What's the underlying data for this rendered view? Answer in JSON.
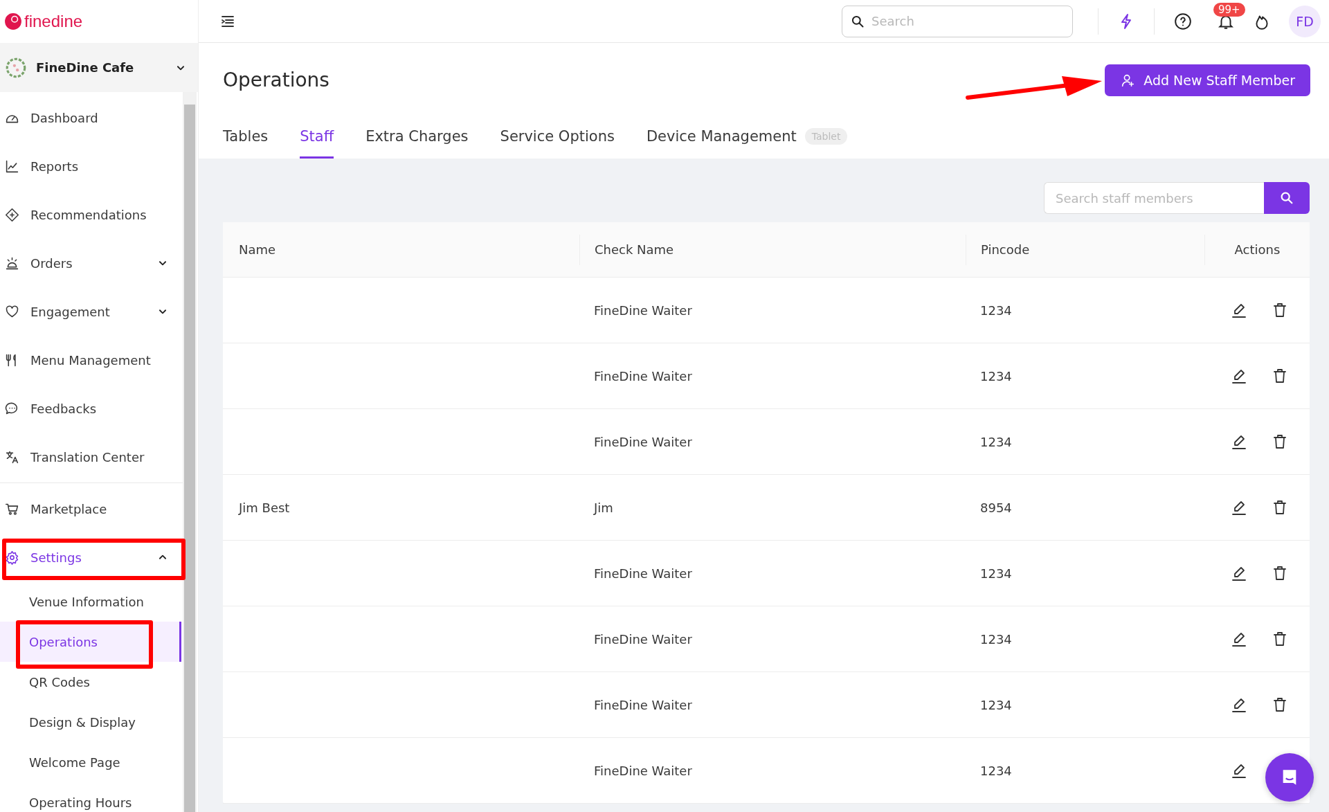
{
  "brand": {
    "name": "finedine"
  },
  "venue": {
    "name": "FineDine Cafe",
    "expanded": false
  },
  "sidebar": {
    "items": [
      {
        "kind": "link",
        "label": "Dashboard"
      },
      {
        "kind": "link",
        "label": "Reports"
      },
      {
        "kind": "link",
        "label": "Recommendations"
      },
      {
        "kind": "group",
        "label": "Orders",
        "expanded": false
      },
      {
        "kind": "group",
        "label": "Engagement",
        "expanded": false
      },
      {
        "kind": "link",
        "label": "Menu Management"
      },
      {
        "kind": "link",
        "label": "Feedbacks"
      },
      {
        "kind": "link",
        "label": "Translation Center"
      },
      {
        "kind": "divider"
      },
      {
        "kind": "link",
        "label": "Marketplace"
      },
      {
        "kind": "group",
        "label": "Settings",
        "expanded": true,
        "selected": true,
        "annotated": true,
        "children": [
          {
            "label": "Venue Information",
            "selected": false,
            "annotated": false
          },
          {
            "label": "Operations",
            "selected": true,
            "annotated": true
          },
          {
            "label": "QR Codes",
            "selected": false,
            "annotated": false
          },
          {
            "label": "Design & Display",
            "selected": false,
            "annotated": false
          },
          {
            "label": "Welcome Page",
            "selected": false,
            "annotated": false
          },
          {
            "label": "Operating Hours",
            "selected": false,
            "annotated": false
          }
        ]
      }
    ]
  },
  "topbar": {
    "search": {
      "placeholder": "Search"
    },
    "notifications": {
      "badge": "99+"
    },
    "avatar": {
      "initials": "FD"
    }
  },
  "page": {
    "title": "Operations",
    "primary_button": {
      "label": "Add New Staff Member",
      "annotated": true
    }
  },
  "tabs": [
    {
      "label": "Tables",
      "selected": false
    },
    {
      "label": "Staff",
      "selected": true
    },
    {
      "label": "Extra Charges",
      "selected": false
    },
    {
      "label": "Service Options",
      "selected": false
    },
    {
      "label": "Device Management",
      "selected": false,
      "badge": "Tablet"
    }
  ],
  "staff_search": {
    "placeholder": "Search staff members"
  },
  "table": {
    "columns": [
      "Name",
      "Check Name",
      "Pincode",
      "Actions"
    ],
    "rows": [
      {
        "check_name": "FineDine Waiter",
        "pincode": "1234"
      },
      {
        "check_name": "FineDine Waiter",
        "pincode": "1234"
      },
      {
        "check_name": "FineDine Waiter",
        "pincode": "1234"
      },
      {
        "name": "Jim Best",
        "check_name": "Jim",
        "pincode": "8954"
      },
      {
        "check_name": "FineDine Waiter",
        "pincode": "1234"
      },
      {
        "check_name": "FineDine Waiter",
        "pincode": "1234"
      },
      {
        "check_name": "FineDine Waiter",
        "pincode": "1234"
      },
      {
        "check_name": "FineDine Waiter",
        "pincode": "1234"
      }
    ]
  }
}
